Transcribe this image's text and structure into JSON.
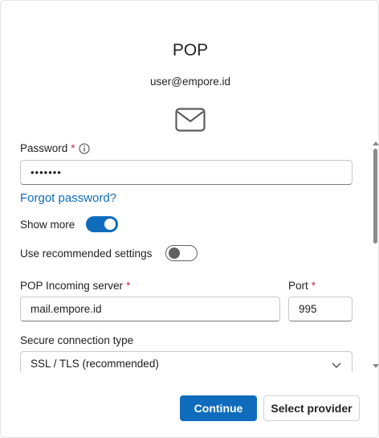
{
  "dialog": {
    "title": "POP",
    "account_email": "user@empore.id",
    "icon": "mail-icon"
  },
  "form": {
    "password": {
      "label": "Password",
      "required_marker": "*",
      "value": "•••••••",
      "info_icon": "info-icon"
    },
    "forgot_password_link": "Forgot password?",
    "show_more": {
      "label": "Show more",
      "checked": true
    },
    "use_recommended": {
      "label": "Use recommended settings",
      "checked": false
    },
    "incoming_server": {
      "label": "POP Incoming server",
      "required_marker": "*",
      "value": "mail.empore.id"
    },
    "port": {
      "label": "Port",
      "required_marker": "*",
      "value": "995"
    },
    "secure_connection": {
      "label": "Secure connection type",
      "selected": "SSL / TLS (recommended)"
    }
  },
  "footer": {
    "continue_label": "Continue",
    "select_provider_label": "Select provider"
  },
  "colors": {
    "accent": "#0f6cbd",
    "required": "#c4314b"
  }
}
